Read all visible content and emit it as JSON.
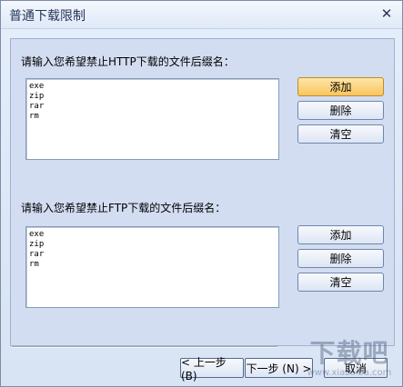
{
  "window": {
    "title": "普通下载限制",
    "close_glyph": "✕"
  },
  "http_section": {
    "caption": "请输入您希望禁止HTTP下载的文件后缀名：",
    "items": [
      "exe",
      "zip",
      "rar",
      "rm"
    ],
    "buttons": {
      "add": "添加",
      "delete": "删除",
      "clear": "清空"
    }
  },
  "ftp_section": {
    "caption": "请输入您希望禁止FTP下载的文件后缀名：",
    "items": [
      "exe",
      "zip",
      "rar",
      "rm"
    ],
    "buttons": {
      "add": "添加",
      "delete": "删除",
      "clear": "清空"
    }
  },
  "footer": {
    "back": "< 上一步 (B)",
    "next": "下一步 (N) >",
    "cancel": "取消"
  },
  "watermark": {
    "logo_text": "下载吧",
    "url": "www.xiazaiba.com"
  },
  "colors": {
    "dialog_bg": "#dce6f6",
    "active_button": "#f8c560"
  }
}
